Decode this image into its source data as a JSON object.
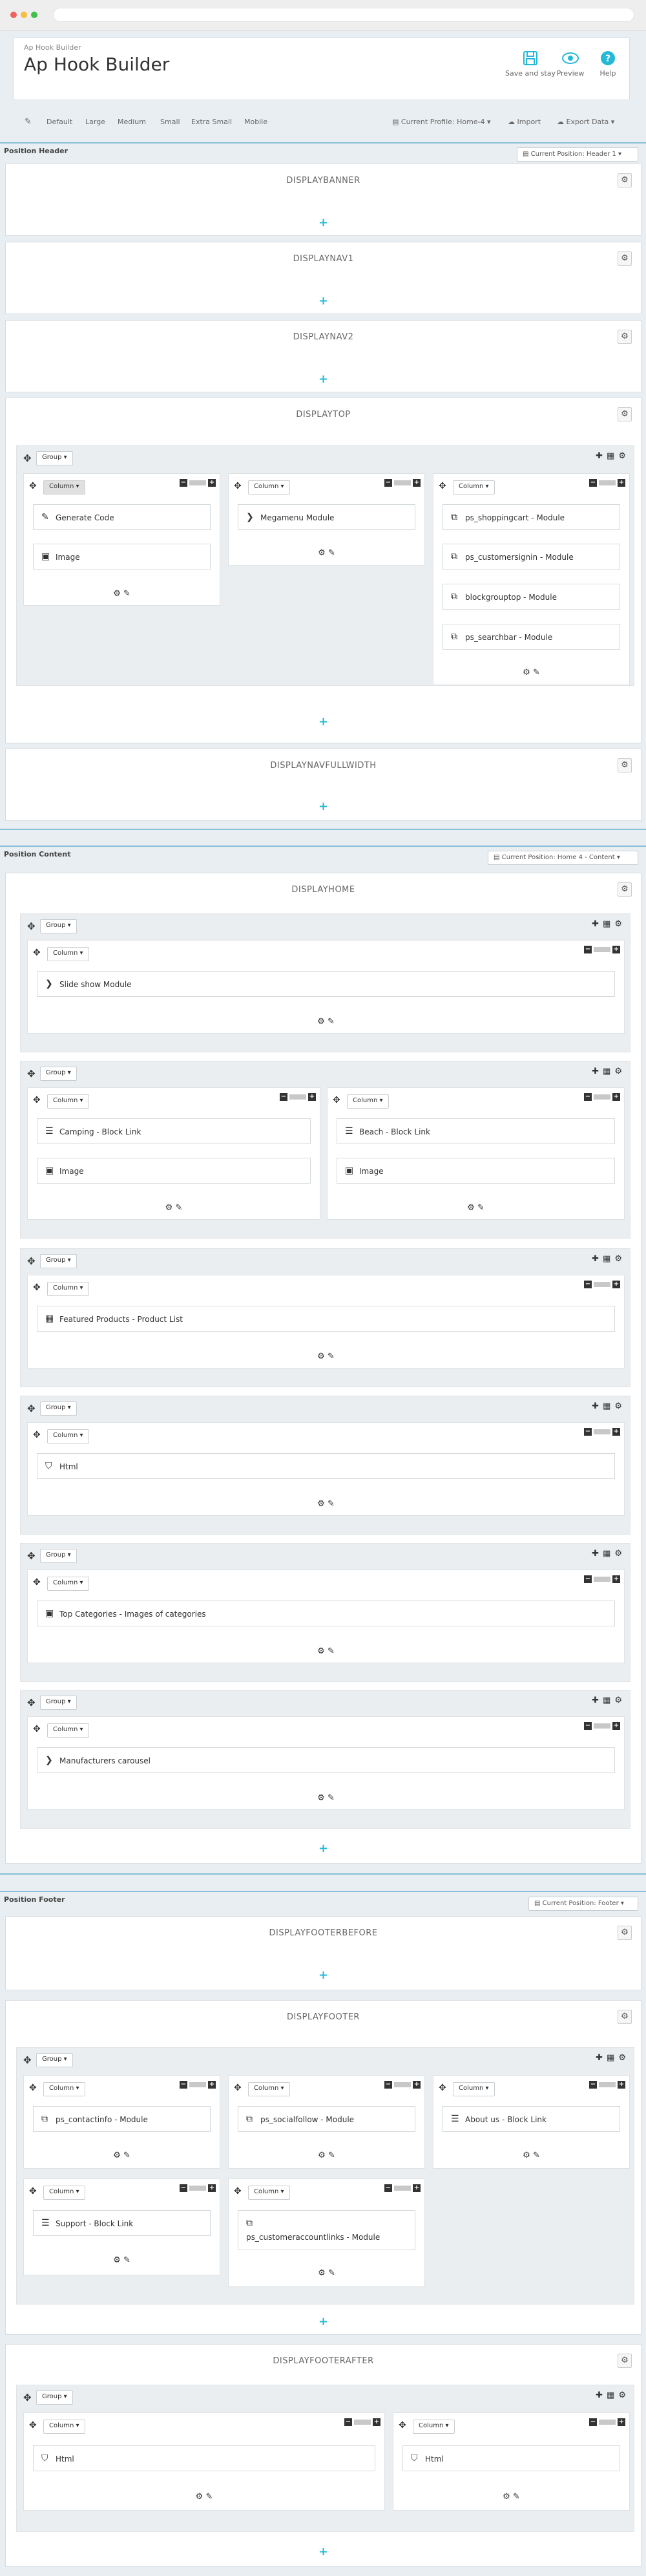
{
  "toolbar": {
    "breadcrumb": "Ap Hook Builder",
    "title": "Ap Hook Builder",
    "save_label": "Save and stay",
    "preview_label": "Preview",
    "help_label": "Help"
  },
  "subbar": {
    "sizes": [
      "Default",
      "Large",
      "Medium",
      "Small",
      "Extra Small",
      "Mobile"
    ],
    "profile": "Current Profile: Home-4 ▾",
    "import": "Import",
    "export": "Export Data ▾"
  },
  "positions": {
    "header": {
      "title": "Position Header",
      "current": "Current Position: Header 1 ▾"
    },
    "content": {
      "title": "Position Content",
      "current": "Current Position: Home 4 - Content ▾"
    },
    "footer": {
      "title": "Position Footer",
      "current": "Current Position: Footer ▾"
    }
  },
  "labels": {
    "group": "Group ▾",
    "column": "Column ▾",
    "add": "+",
    "gear": "⚙",
    "col_footer": "⚙ ✎"
  },
  "hooks": {
    "banner": "DISPLAYBANNER",
    "nav1": "DISPLAYNAV1",
    "nav2": "DISPLAYNAV2",
    "top": "DISPLAYTOP",
    "navfull": "DISPLAYNAVFULLWIDTH",
    "home": "DISPLAYHOME",
    "footerbefore": "DISPLAYFOOTERBEFORE",
    "footer": "DISPLAYFOOTER",
    "footerafter": "DISPLAYFOOTERAFTER"
  },
  "modules": {
    "top_c1": [
      "Generate Code",
      "Image"
    ],
    "top_c2": [
      "Megamenu Module"
    ],
    "top_c3": [
      "ps_shoppingcart - Module",
      "ps_customersignin - Module",
      "blockgrouptop - Module",
      "ps_searchbar - Module"
    ],
    "home_g1": [
      "Slide show Module"
    ],
    "home_g2a": [
      "Camping - Block Link",
      "Image"
    ],
    "home_g2b": [
      "Beach - Block Link",
      "Image"
    ],
    "home_g3": [
      "Featured Products - Product List"
    ],
    "home_g4": [
      "Html"
    ],
    "home_g5": [
      "Top Categories - Images of categories"
    ],
    "home_g6": [
      "Manufacturers carousel"
    ],
    "footer_c1": [
      "ps_contactinfo - Module"
    ],
    "footer_c2": [
      "ps_socialfollow - Module"
    ],
    "footer_c3": [
      "About us - Block Link"
    ],
    "footer_c4": [
      "Support - Block Link"
    ],
    "footer_c5": [
      "ps_customeraccountlinks - Module"
    ],
    "after_c1": [
      "Html"
    ],
    "after_c2": [
      "Html"
    ]
  }
}
